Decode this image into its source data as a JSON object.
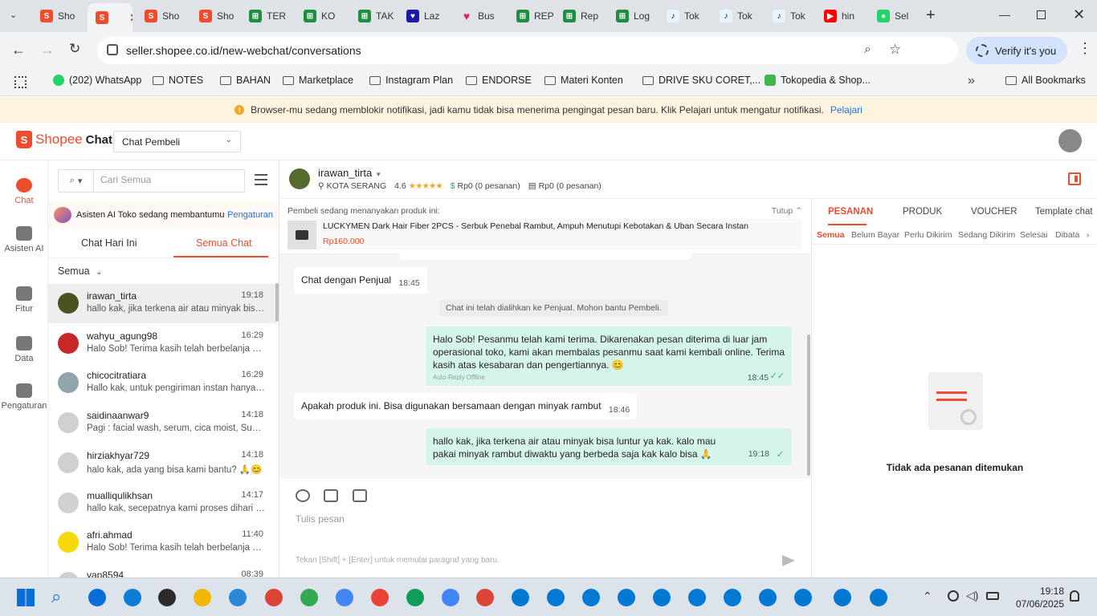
{
  "browser": {
    "tabs": [
      {
        "label": "Sho",
        "icon": "shopee"
      },
      {
        "label": "",
        "icon": "shopee",
        "active": true
      },
      {
        "label": "Sho",
        "icon": "shopee"
      },
      {
        "label": "Sho",
        "icon": "shopee"
      },
      {
        "label": "TER",
        "icon": "sheets"
      },
      {
        "label": "KO",
        "icon": "sheets"
      },
      {
        "label": "TAK",
        "icon": "sheets"
      },
      {
        "label": "Laz",
        "icon": "lazada"
      },
      {
        "label": "Bus",
        "icon": "heart"
      },
      {
        "label": "REP",
        "icon": "sheets"
      },
      {
        "label": "Rep",
        "icon": "sheets"
      },
      {
        "label": "Log",
        "icon": "sheets"
      },
      {
        "label": "Tok",
        "icon": "tiktok"
      },
      {
        "label": "Tok",
        "icon": "tiktok"
      },
      {
        "label": "Tok",
        "icon": "tiktok"
      },
      {
        "label": "hin",
        "icon": "youtube"
      },
      {
        "label": "Sel",
        "icon": "frog"
      }
    ],
    "url": "seller.shopee.co.id/new-webchat/conversations",
    "verify_label": "Verify it's you",
    "bookmarks": [
      {
        "label": "(202) WhatsApp",
        "type": "whatsapp"
      },
      {
        "label": "NOTES",
        "type": "folder"
      },
      {
        "label": "BAHAN",
        "type": "folder"
      },
      {
        "label": "Marketplace",
        "type": "folder"
      },
      {
        "label": "Instagram Plan",
        "type": "folder"
      },
      {
        "label": "ENDORSE",
        "type": "folder"
      },
      {
        "label": "Materi Konten",
        "type": "folder"
      },
      {
        "label": "DRIVE SKU CORET,...",
        "type": "folder"
      },
      {
        "label": "Tokopedia & Shop...",
        "type": "tokopedia"
      }
    ],
    "all_bookmarks": "All Bookmarks"
  },
  "notification": {
    "text": "Browser-mu sedang memblokir notifikasi, jadi kamu tidak bisa menerima pengingat pesan baru. Klik Pelajari untuk mengatur notifikasi.",
    "link": "Pelajari"
  },
  "header": {
    "brand": "Shopee",
    "product": "Chat",
    "role_select": "Chat Pembeli"
  },
  "nav": [
    {
      "label": "Chat",
      "active": true
    },
    {
      "label": "Asisten AI"
    },
    {
      "label": "Fitur"
    },
    {
      "label": "Data"
    },
    {
      "label": "Pengaturan"
    }
  ],
  "conv_list": {
    "search_placeholder": "Cari Semua",
    "ai_banner": "Asisten AI Toko sedang membantumu",
    "ai_link": "Pengaturan",
    "tab_today": "Chat Hari Ini",
    "tab_all": "Semua Chat",
    "filter": "Semua",
    "items": [
      {
        "name": "irawan_tirta",
        "time": "19:18",
        "preview": "hallo kak, jika terkena air atau minyak bisa luntur ya kak.",
        "selected": true,
        "avatar_color": "#4b5320"
      },
      {
        "name": "wahyu_agung98",
        "time": "16:29",
        "preview": "Halo Sob! Terima kasih telah berbelanja di toko kami",
        "avatar_color": "#c62828"
      },
      {
        "name": "chicocitratiara",
        "time": "16:29",
        "preview": "Hallo kak, untuk pengiriman instan hanya berlaku",
        "avatar_color": "#90a4ae"
      },
      {
        "name": "saidinaanwar9",
        "time": "14:18",
        "preview": "Pagi : facial wash, serum, cica moist, Sunscreen",
        "avatar_color": "#d0d0d0"
      },
      {
        "name": "hirziakhyar729",
        "time": "14:18",
        "preview": "halo kak, ada yang bisa kami bantu? 🙏😊",
        "avatar_color": "#d0d0d0"
      },
      {
        "name": "mualliqulikhsan",
        "time": "14:17",
        "preview": "hallo kak, secepatnya kami proses dihari ini ya kak",
        "avatar_color": "#d0d0d0"
      },
      {
        "name": "afri.ahmad",
        "time": "11:40",
        "preview": "Halo Sob! Terima kasih telah berbelanja di toko kami",
        "avatar_color": "#f5d90a"
      },
      {
        "name": "yap8594",
        "time": "08:39",
        "preview": "",
        "avatar_color": "#d0d0d0"
      }
    ]
  },
  "chat": {
    "buyer_name": "irawan_tirta",
    "location": "KOTA SERANG",
    "rating": "4.6",
    "stat1": "Rp0 (0 pesanan)",
    "stat2": "Rp0 (0 pesanan)",
    "product_banner_title": "Pembeli sedang menanyakan produk ini:",
    "product_banner_close": "Tutup",
    "product_name": "LUCKYMEN Dark Hair Fiber 2PCS - Serbuk Penebal Rambut, Ampuh Menutupi Kebotakan & Uban Secara Instan",
    "product_price": "Rp160.000",
    "messages": [
      {
        "dir": "in",
        "text": "Chat dengan Penjual",
        "time": "18:45"
      },
      {
        "dir": "sys",
        "text": "Chat ini telah dialihkan ke Penjual. Mohon bantu Pembeli."
      },
      {
        "dir": "out",
        "text": "Halo Sob! Pesanmu telah kami terima. Dikarenakan pesan diterima di luar jam operasional toko, kami akan membalas pesanmu saat kami kembali online. Terima kasih atas kesabaran dan pengertiannya. 😊",
        "time": "18:45",
        "tag": "Auto-Reply Offline"
      },
      {
        "dir": "in",
        "text": "Apakah produk ini. Bisa digunakan bersamaan dengan minyak rambut",
        "time": "18:46"
      },
      {
        "dir": "out",
        "text": "hallo kak, jika terkena air atau minyak bisa luntur ya kak. kalo mau pakai minyak rambut diwaktu yang berbeda saja kak kalo bisa 🙏",
        "time": "19:18"
      }
    ],
    "composer_placeholder": "Tulis pesan",
    "composer_hint": "Tekan [Shift] + [Enter] untuk memulai paragraf yang baru."
  },
  "right_panel": {
    "tabs": [
      "PESANAN",
      "PRODUK",
      "VOUCHER",
      "Template chat"
    ],
    "sub_tabs": [
      "Semua",
      "Belum Bayar",
      "Perlu Dikirim",
      "Sedang Dikirim",
      "Selesai",
      "Dibata"
    ],
    "empty_text": "Tidak ada pesanan ditemukan"
  },
  "taskbar": {
    "time": "19:18",
    "date": "07/06/2025"
  }
}
